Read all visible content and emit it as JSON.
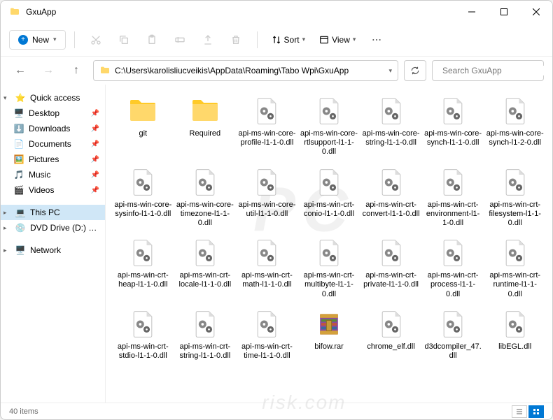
{
  "title": "GxuApp",
  "toolbar": {
    "new_label": "New",
    "sort_label": "Sort",
    "view_label": "View"
  },
  "address": {
    "path": "C:\\Users\\karolisliucveikis\\AppData\\Roaming\\Tabo Wpi\\GxuApp"
  },
  "search": {
    "placeholder": "Search GxuApp"
  },
  "sidebar": {
    "quick_access": "Quick access",
    "items": [
      {
        "label": "Desktop",
        "icon": "desktop"
      },
      {
        "label": "Downloads",
        "icon": "downloads"
      },
      {
        "label": "Documents",
        "icon": "documents"
      },
      {
        "label": "Pictures",
        "icon": "pictures"
      },
      {
        "label": "Music",
        "icon": "music"
      },
      {
        "label": "Videos",
        "icon": "videos"
      }
    ],
    "this_pc": "This PC",
    "dvd": "DVD Drive (D:) CCCC",
    "network": "Network"
  },
  "files": [
    {
      "name": "git",
      "type": "folder"
    },
    {
      "name": "Required",
      "type": "folder"
    },
    {
      "name": "api-ms-win-core-profile-l1-1-0.dll",
      "type": "dll"
    },
    {
      "name": "api-ms-win-core-rtlsupport-l1-1-0.dll",
      "type": "dll"
    },
    {
      "name": "api-ms-win-core-string-l1-1-0.dll",
      "type": "dll"
    },
    {
      "name": "api-ms-win-core-synch-l1-1-0.dll",
      "type": "dll"
    },
    {
      "name": "api-ms-win-core-synch-l1-2-0.dll",
      "type": "dll"
    },
    {
      "name": "api-ms-win-core-sysinfo-l1-1-0.dll",
      "type": "dll"
    },
    {
      "name": "api-ms-win-core-timezone-l1-1-0.dll",
      "type": "dll"
    },
    {
      "name": "api-ms-win-core-util-l1-1-0.dll",
      "type": "dll"
    },
    {
      "name": "api-ms-win-crt-conio-l1-1-0.dll",
      "type": "dll"
    },
    {
      "name": "api-ms-win-crt-convert-l1-1-0.dll",
      "type": "dll"
    },
    {
      "name": "api-ms-win-crt-environment-l1-1-0.dll",
      "type": "dll"
    },
    {
      "name": "api-ms-win-crt-filesystem-l1-1-0.dll",
      "type": "dll"
    },
    {
      "name": "api-ms-win-crt-heap-l1-1-0.dll",
      "type": "dll"
    },
    {
      "name": "api-ms-win-crt-locale-l1-1-0.dll",
      "type": "dll"
    },
    {
      "name": "api-ms-win-crt-math-l1-1-0.dll",
      "type": "dll"
    },
    {
      "name": "api-ms-win-crt-multibyte-l1-1-0.dll",
      "type": "dll"
    },
    {
      "name": "api-ms-win-crt-private-l1-1-0.dll",
      "type": "dll"
    },
    {
      "name": "api-ms-win-crt-process-l1-1-0.dll",
      "type": "dll"
    },
    {
      "name": "api-ms-win-crt-runtime-l1-1-0.dll",
      "type": "dll"
    },
    {
      "name": "api-ms-win-crt-stdio-l1-1-0.dll",
      "type": "dll"
    },
    {
      "name": "api-ms-win-crt-string-l1-1-0.dll",
      "type": "dll"
    },
    {
      "name": "api-ms-win-crt-time-l1-1-0.dll",
      "type": "dll"
    },
    {
      "name": "bifow.rar",
      "type": "rar"
    },
    {
      "name": "chrome_elf.dll",
      "type": "dll"
    },
    {
      "name": "d3dcompiler_47.dll",
      "type": "dll"
    },
    {
      "name": "libEGL.dll",
      "type": "dll"
    }
  ],
  "status": {
    "count": "40 items"
  },
  "watermark": "PC",
  "watermark2": "risk.com"
}
